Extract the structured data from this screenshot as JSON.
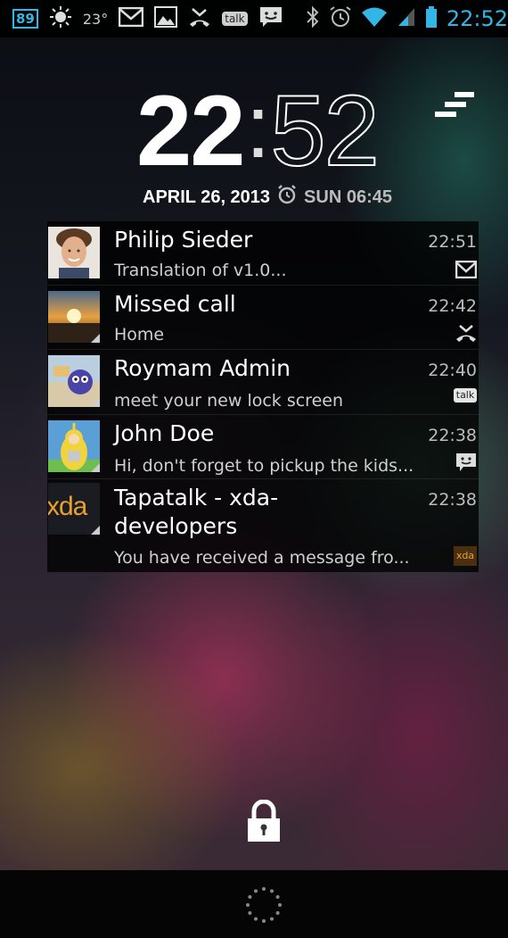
{
  "statusbar": {
    "battery_percent": "89",
    "temperature": "23°",
    "time": "22:52",
    "left_icons": [
      "battery-percent-icon",
      "weather-icon",
      "gmail-icon",
      "gallery-icon",
      "missed-call-icon",
      "talk-icon",
      "sms-icon"
    ],
    "right_icons": [
      "bluetooth-icon",
      "alarm-icon",
      "wifi-icon",
      "signal-icon",
      "battery-icon"
    ]
  },
  "clock": {
    "hours": "22",
    "colon": ":",
    "minutes": "52"
  },
  "date": {
    "text": "APRIL 26, 2013",
    "alarm_text": "SUN 06:45"
  },
  "notifications": [
    {
      "title": "Philip Sieder",
      "subtitle": "Translation of v1.0...",
      "time": "22:51",
      "icon": "gmail-icon"
    },
    {
      "title": "Missed call",
      "subtitle": "Home",
      "time": "22:42",
      "icon": "missed-call-icon"
    },
    {
      "title": "Roymam Admin",
      "subtitle": "meet your new lock screen",
      "time": "22:40",
      "icon": "talk-icon",
      "icon_text": "talk"
    },
    {
      "title": "John Doe",
      "subtitle": "Hi,  don't forget to pickup the kids...",
      "time": "22:38",
      "icon": "sms-icon"
    },
    {
      "title_line1": "Tapatalk - xda-",
      "title_line2": "developers",
      "subtitle": "You have received a message fro...",
      "time": "22:38",
      "icon": "tapatalk-icon",
      "icon_text": "xda",
      "avatar_text": "xda"
    }
  ],
  "colors": {
    "accent": "#33b5e5",
    "xda_orange": "#e8a030"
  },
  "lock_icon": "padlock-icon",
  "spinner_icon": "loading-spinner-icon"
}
